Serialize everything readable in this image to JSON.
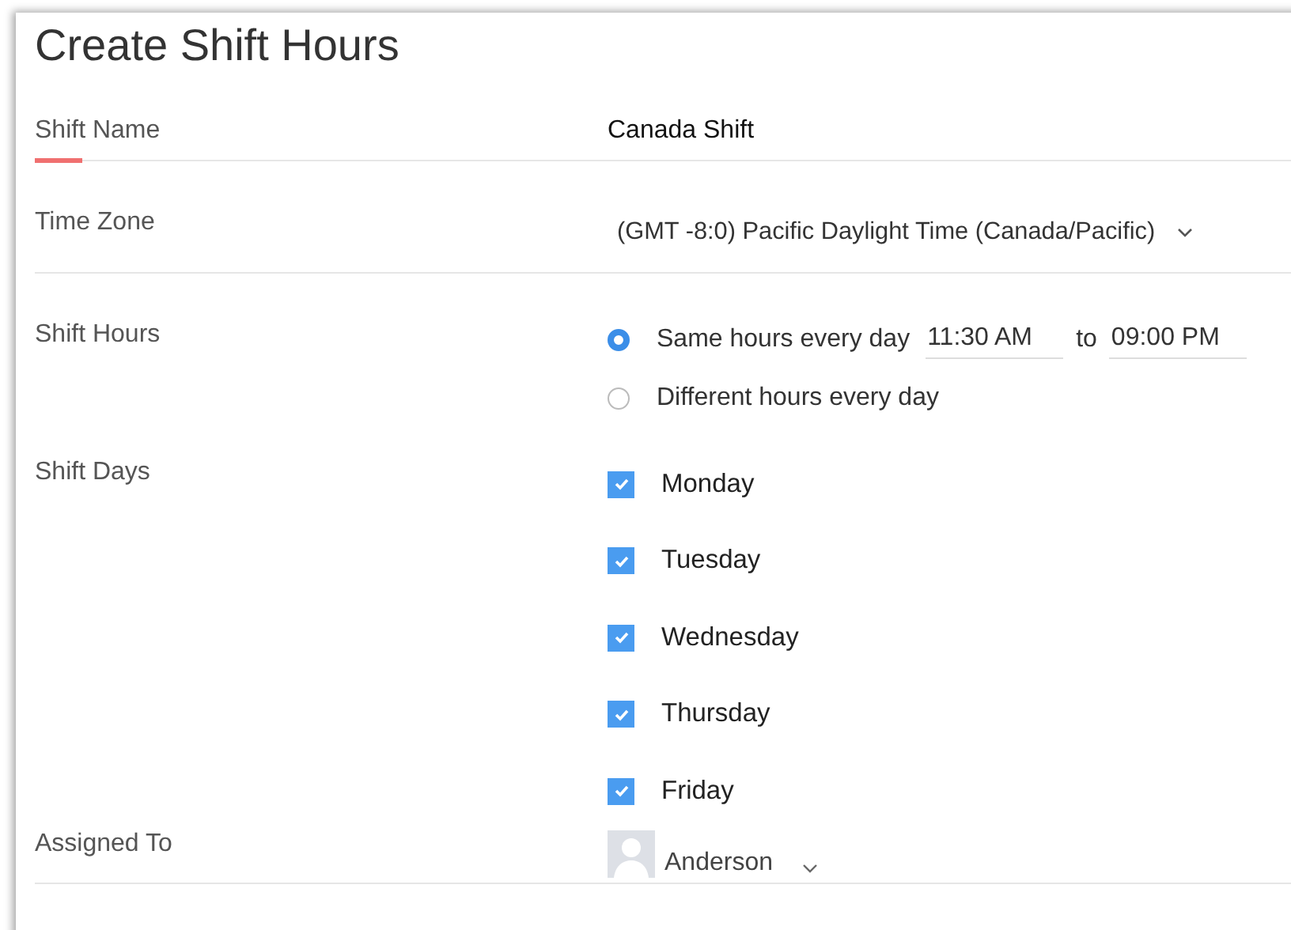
{
  "title": "Create Shift Hours",
  "shift_name": {
    "label": "Shift Name",
    "value": "Canada Shift",
    "focused": true
  },
  "time_zone": {
    "label": "Time Zone",
    "value": "(GMT -8:0) Pacific Daylight Time (Canada/Pacific)"
  },
  "shift_hours": {
    "label": "Shift Hours",
    "options": [
      {
        "label": "Same hours every day",
        "selected": true,
        "from": "11:30 AM",
        "to_label": "to",
        "to": "09:00 PM"
      },
      {
        "label": "Different hours every day",
        "selected": false
      }
    ]
  },
  "shift_days": {
    "label": "Shift Days",
    "days": [
      {
        "label": "Monday",
        "checked": true
      },
      {
        "label": "Tuesday",
        "checked": true
      },
      {
        "label": "Wednesday",
        "checked": true
      },
      {
        "label": "Thursday",
        "checked": true
      },
      {
        "label": "Friday",
        "checked": true
      }
    ]
  },
  "assigned_to": {
    "label": "Assigned To",
    "value": "Anderson"
  }
}
